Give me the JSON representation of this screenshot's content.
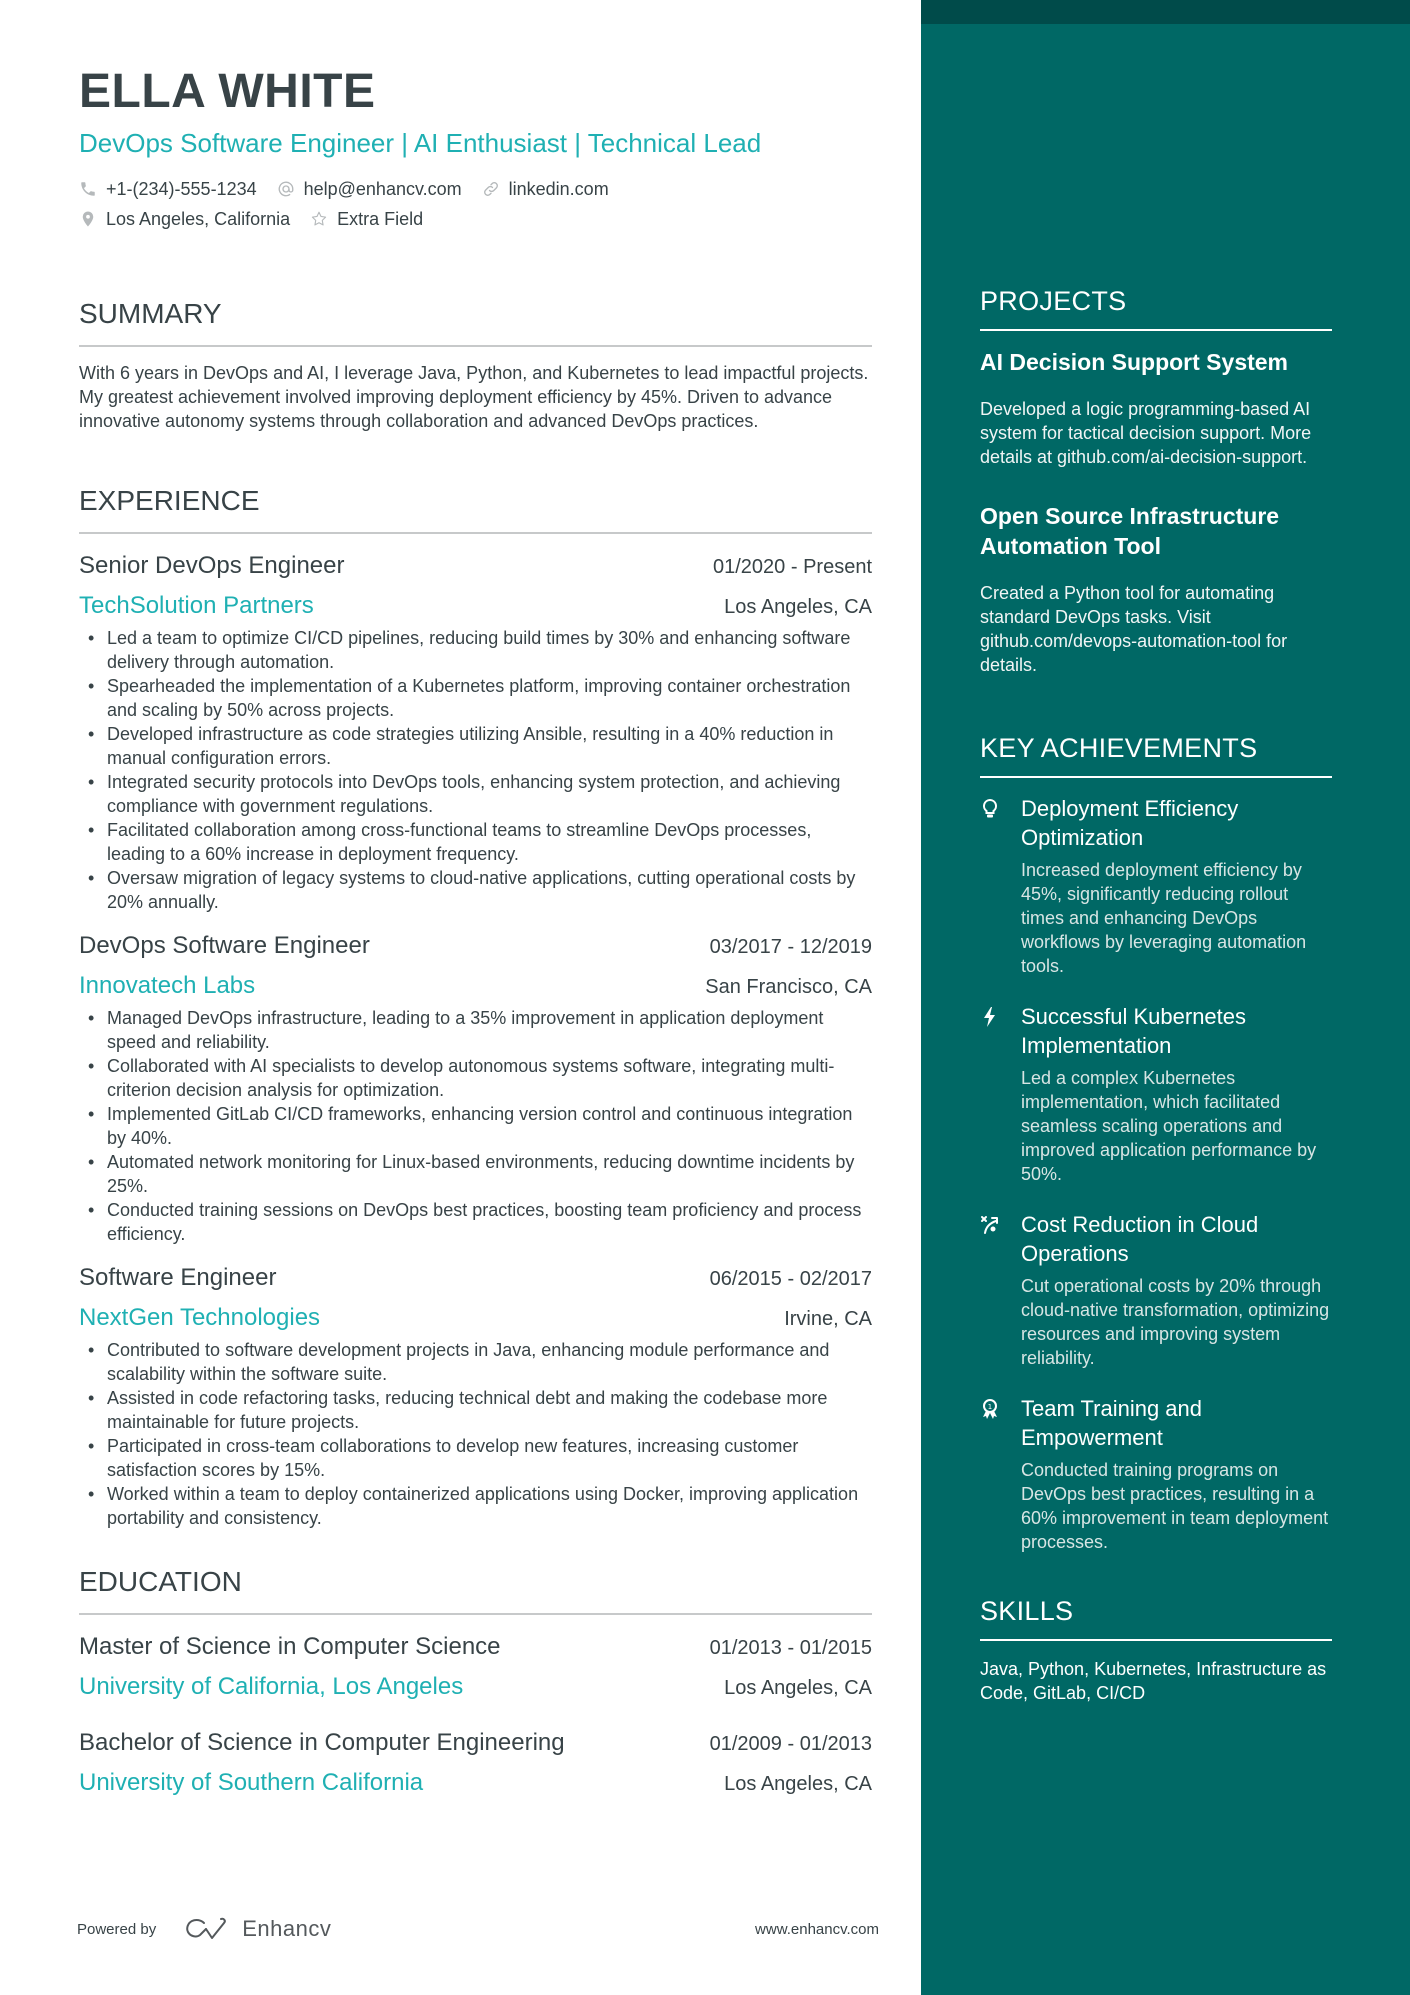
{
  "header": {
    "name": "ELLA WHITE",
    "headline": "DevOps Software Engineer | AI Enthusiast | Technical Lead",
    "contacts": {
      "phone": "+1-(234)-555-1234",
      "email": "help@enhancv.com",
      "link": "linkedin.com",
      "location": "Los Angeles, California",
      "extra": "Extra Field"
    }
  },
  "summary": {
    "heading": "SUMMARY",
    "text": "With 6 years in DevOps and AI, I leverage Java, Python, and Kubernetes to lead impactful projects. My greatest achievement involved improving deployment efficiency by 45%. Driven to advance innovative autonomy systems through collaboration and advanced DevOps practices."
  },
  "experience": {
    "heading": "EXPERIENCE",
    "jobs": [
      {
        "title": "Senior DevOps Engineer",
        "dates": "01/2020 - Present",
        "company": "TechSolution Partners",
        "location": "Los Angeles, CA",
        "bullets": [
          "Led a team to optimize CI/CD pipelines, reducing build times by 30% and enhancing software delivery through automation.",
          "Spearheaded the implementation of a Kubernetes platform, improving container orchestration and scaling by 50% across projects.",
          "Developed infrastructure as code strategies utilizing Ansible, resulting in a 40% reduction in manual configuration errors.",
          "Integrated security protocols into DevOps tools, enhancing system protection, and achieving compliance with government regulations.",
          "Facilitated collaboration among cross-functional teams to streamline DevOps processes, leading to a 60% increase in deployment frequency.",
          "Oversaw migration of legacy systems to cloud-native applications, cutting operational costs by 20% annually."
        ]
      },
      {
        "title": "DevOps Software Engineer",
        "dates": "03/2017 - 12/2019",
        "company": "Innovatech Labs",
        "location": "San Francisco, CA",
        "bullets": [
          "Managed DevOps infrastructure, leading to a 35% improvement in application deployment speed and reliability.",
          "Collaborated with AI specialists to develop autonomous systems software, integrating multi-criterion decision analysis for optimization.",
          "Implemented GitLab CI/CD frameworks, enhancing version control and continuous integration by 40%.",
          "Automated network monitoring for Linux-based environments, reducing downtime incidents by 25%.",
          "Conducted training sessions on DevOps best practices, boosting team proficiency and process efficiency."
        ]
      },
      {
        "title": "Software Engineer",
        "dates": "06/2015 - 02/2017",
        "company": "NextGen Technologies",
        "location": "Irvine, CA",
        "bullets": [
          "Contributed to software development projects in Java, enhancing module performance and scalability within the software suite.",
          "Assisted in code refactoring tasks, reducing technical debt and making the codebase more maintainable for future projects.",
          "Participated in cross-team collaborations to develop new features, increasing customer satisfaction scores by 15%.",
          "Worked within a team to deploy containerized applications using Docker, improving application portability and consistency."
        ]
      }
    ]
  },
  "education": {
    "heading": "EDUCATION",
    "items": [
      {
        "degree": "Master of Science in Computer Science",
        "dates": "01/2013 - 01/2015",
        "school": "University of California, Los Angeles",
        "location": "Los Angeles, CA"
      },
      {
        "degree": "Bachelor of Science in Computer Engineering",
        "dates": "01/2009 - 01/2013",
        "school": "University of Southern California",
        "location": "Los Angeles, CA"
      }
    ]
  },
  "projects": {
    "heading": "PROJECTS",
    "items": [
      {
        "title": "AI Decision Support System",
        "description": "Developed a logic programming-based AI system for tactical decision support. More details at github.com/ai-decision-support."
      },
      {
        "title": "Open Source Infrastructure Automation Tool",
        "description": "Created a Python tool for automating standard DevOps tasks. Visit github.com/devops-automation-tool for details."
      }
    ]
  },
  "achievements": {
    "heading": "KEY ACHIEVEMENTS",
    "items": [
      {
        "icon": "lightbulb-icon",
        "title": "Deployment Efficiency Optimization",
        "description": "Increased deployment efficiency by 45%, significantly reducing rollout times and enhancing DevOps workflows by leveraging automation tools."
      },
      {
        "icon": "lightning-bolt-icon",
        "title": "Successful Kubernetes Implementation",
        "description": "Led a complex Kubernetes implementation, which facilitated seamless scaling operations and improved application performance by 50%."
      },
      {
        "icon": "strategy-path-icon",
        "title": "Cost Reduction in Cloud Operations",
        "description": "Cut operational costs by 20% through cloud-native transformation, optimizing resources and improving system reliability."
      },
      {
        "icon": "award-ribbon-icon",
        "title": "Team Training and Empowerment",
        "description": "Conducted training programs on DevOps best practices, resulting in a 60% improvement in team deployment processes."
      }
    ]
  },
  "skills": {
    "heading": "SKILLS",
    "text": "Java, Python, Kubernetes, Infrastructure as Code, GitLab, CI/CD"
  },
  "footer": {
    "powered_by": "Powered by",
    "brand": "Enhancv",
    "website": "www.enhancv.com"
  },
  "colors": {
    "accent": "#1fb0b3",
    "sidebar": "#006865",
    "sidebar_top": "#004b4a",
    "text": "#384347"
  }
}
